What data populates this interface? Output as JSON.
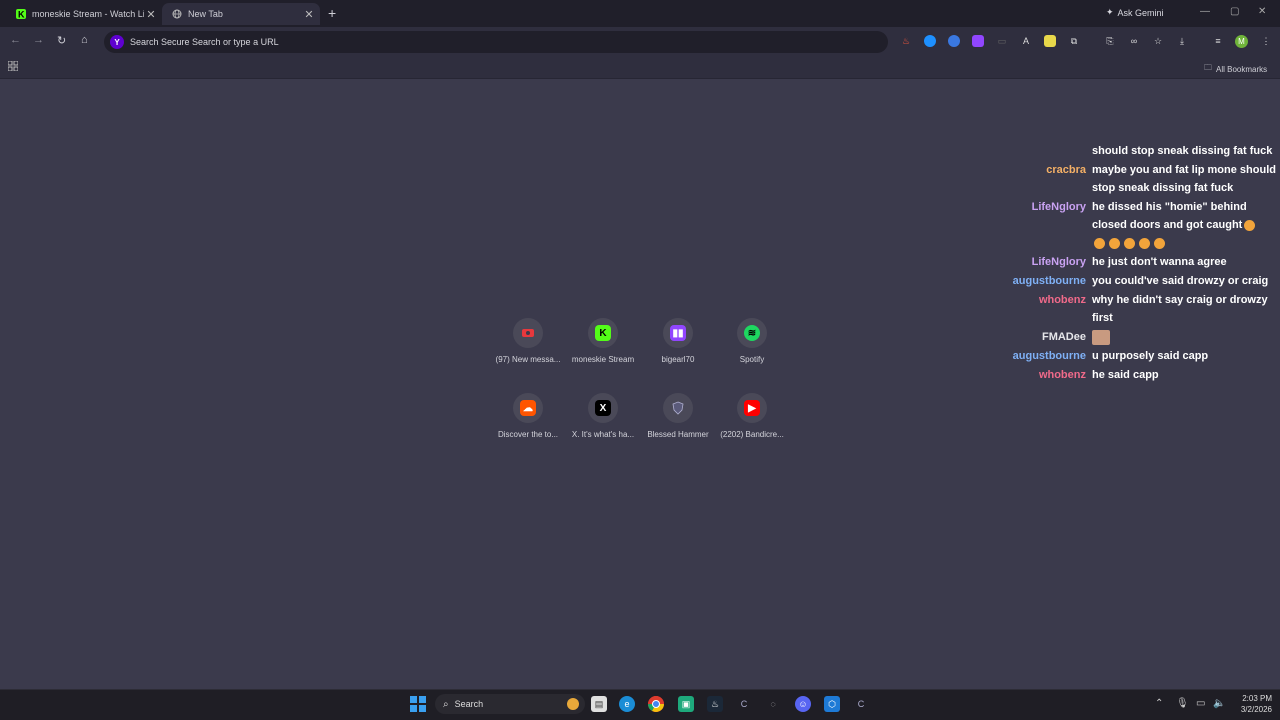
{
  "tabs": [
    {
      "title": "moneskie Stream - Watch Live",
      "icon": "kick-icon"
    },
    {
      "title": "New Tab",
      "icon": "globe-icon"
    }
  ],
  "ask_gemini": "Ask Gemini",
  "omnibox": {
    "placeholder": "Search Secure Search or type a URL"
  },
  "bookmarks": {
    "all_label": "All Bookmarks"
  },
  "shortcuts": [
    {
      "label": "(97) New messa...",
      "icon": "youtube-studio-icon",
      "color": "#e8383d"
    },
    {
      "label": "moneskie Stream",
      "icon": "kick-icon",
      "color": "#53fc18"
    },
    {
      "label": "bigearl70",
      "icon": "twitch-icon",
      "color": "#9146ff"
    },
    {
      "label": "Spotify",
      "icon": "spotify-icon",
      "color": "#1ed760"
    },
    {
      "label": "Discover the to...",
      "icon": "soundcloud-icon",
      "color": "#ff5500"
    },
    {
      "label": "X. It's what's ha...",
      "icon": "x-icon",
      "color": "#000000"
    },
    {
      "label": "Blessed Hammer",
      "icon": "shield-icon",
      "color": "#6a6a8a"
    },
    {
      "label": "(2202) Bandicre...",
      "icon": "youtube-icon",
      "color": "#ff0000"
    }
  ],
  "chat": [
    {
      "user": "",
      "color": "#ffffff",
      "text": "should stop sneak dissing fat fuck"
    },
    {
      "user": "cracbra",
      "color": "#f4b066",
      "text": "maybe you and fat lip mone should stop sneak dissing fat fuck"
    },
    {
      "user": "LifeNglory",
      "color": "#c9a2f2",
      "text": "he dissed his \"homie\" behind closed doors and got caught"
    },
    {
      "user": "LifeNglory",
      "color": "#c9a2f2",
      "text": "he just don't wanna agree"
    },
    {
      "user": "augustbourne",
      "color": "#7fb0f5",
      "text": "you could've said drowzy or craig"
    },
    {
      "user": "whobenz",
      "color": "#f06a8a",
      "text": "why he didn't say craig or drowzy first"
    },
    {
      "user": "FMADee",
      "color": "#ffffff",
      "text": ""
    },
    {
      "user": "augustbourne",
      "color": "#7fb0f5",
      "text": "u purposely said capp"
    },
    {
      "user": "whobenz",
      "color": "#f06a8a",
      "text": "he said capp"
    }
  ],
  "taskbar": {
    "search_label": "Search"
  },
  "clock": {
    "time": "2:03 PM",
    "date": "3/2/2026"
  },
  "profile_initial": "M"
}
